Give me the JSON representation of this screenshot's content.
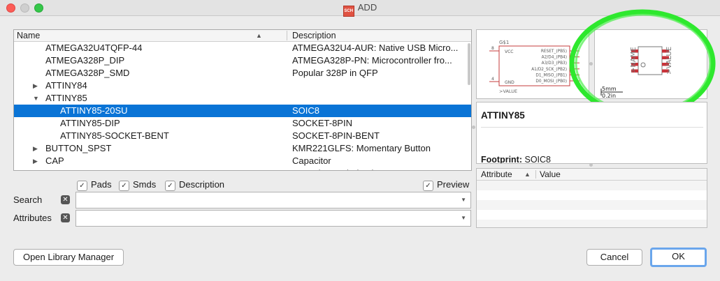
{
  "window": {
    "title": "ADD",
    "icon_label": "SCH"
  },
  "tree": {
    "columns": {
      "name": "Name",
      "description": "Description"
    },
    "rows": [
      {
        "name": "ATMEGA32U4TQFP-44",
        "description": "ATMEGA32U4-AUR: Native USB Micro...",
        "level": 1,
        "expander": ""
      },
      {
        "name": "ATMEGA328P_DIP",
        "description": "ATMEGA328P-PN: Microcontroller fro...",
        "level": 1,
        "expander": ""
      },
      {
        "name": "ATMEGA328P_SMD",
        "description": "Popular 328P in QFP",
        "level": 1,
        "expander": ""
      },
      {
        "name": "ATTINY84",
        "description": "",
        "level": 1,
        "expander": "▶"
      },
      {
        "name": "ATTINY85",
        "description": "",
        "level": 1,
        "expander": "▼"
      },
      {
        "name": "ATTINY85-20SU",
        "description": "SOIC8",
        "level": 2,
        "expander": "",
        "selected": true
      },
      {
        "name": "ATTINY85-DIP",
        "description": "SOCKET-8PIN",
        "level": 2,
        "expander": ""
      },
      {
        "name": "ATTINY85-SOCKET-BENT",
        "description": "SOCKET-8PIN-BENT",
        "level": 2,
        "expander": ""
      },
      {
        "name": "BUTTON_SPST",
        "description": "KMR221GLFS: Momentary Button",
        "level": 1,
        "expander": "▶"
      },
      {
        "name": "CAP",
        "description": "Capacitor",
        "level": 1,
        "expander": "▶"
      },
      {
        "name": "CAP_POL",
        "description": "Capacitor, Polarized",
        "level": 1,
        "expander": "▶"
      }
    ]
  },
  "options": {
    "pads_label": "Pads",
    "pads_checked": true,
    "smds_label": "Smds",
    "smds_checked": true,
    "description_label": "Description",
    "description_checked": true,
    "preview_label": "Preview",
    "preview_checked": true,
    "check_glyph": "✓"
  },
  "search": {
    "label": "Search",
    "value": ""
  },
  "attributes_filter": {
    "label": "Attributes",
    "value": ""
  },
  "symbol_preview": {
    "designator": "G$1",
    "left_pins": [
      {
        "num": "8",
        "name": "VCC"
      },
      {
        "num": "4",
        "name": "GND"
      }
    ],
    "right_pins": [
      "RESET_(PB5)",
      "A2/D4_(PB4)",
      "A3/D3_(PB3)",
      "A1/D2_SCK_(PB2)",
      "D1_MISO_(PB1)",
      "D0_MOSI_(PB0)"
    ],
    "value_label": ">VALUE"
  },
  "package_preview": {
    "name_label": ">NAME",
    "value_label": ">VALUE",
    "scale_mm": "5mm",
    "scale_in": "0.2in"
  },
  "info": {
    "title": "ATTINY85",
    "footprint_label": "Footprint:",
    "footprint_value": "SOIC8"
  },
  "attr_table": {
    "columns": {
      "attribute": "Attribute",
      "value": "Value"
    }
  },
  "buttons": {
    "library_manager": "Open Library Manager",
    "cancel": "Cancel",
    "ok": "OK"
  },
  "colors": {
    "selection": "#0a74d6",
    "annotation_circle": "#2ee82e",
    "symbol_red": "#c43b3b",
    "pad_red": "#c8333a"
  }
}
